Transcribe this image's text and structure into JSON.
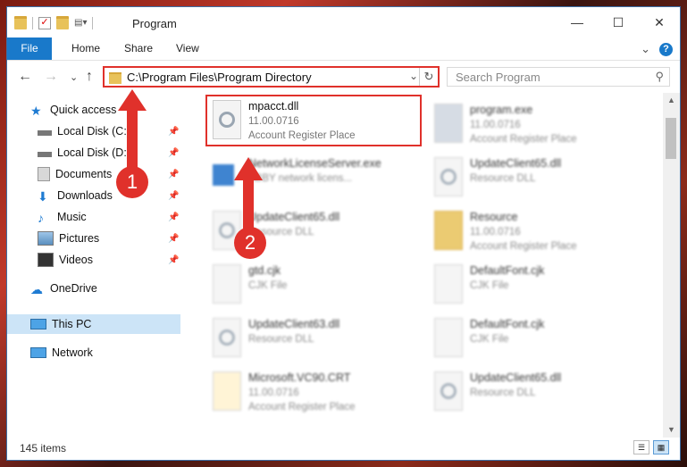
{
  "window": {
    "title": "Program",
    "minimize": "—",
    "maximize": "☐",
    "close": "✕"
  },
  "ribbon": {
    "file": "File",
    "home": "Home",
    "share": "Share",
    "view": "View",
    "collapse": "⌄",
    "help": "?"
  },
  "nav": {
    "back": "←",
    "forward": "→",
    "recent": "⌄",
    "up": "↑"
  },
  "address": {
    "path": "C:\\Program Files\\Program Directory",
    "dropdown": "⌄",
    "refresh": "↻"
  },
  "search": {
    "placeholder": "Search Program",
    "icon": "⚲"
  },
  "sidebar": {
    "items": [
      {
        "label": "Quick access",
        "icon": "star-icon"
      },
      {
        "label": "Local Disk (C:)",
        "icon": "drive-icon"
      },
      {
        "label": "Local Disk (D:)",
        "icon": "drive-icon"
      },
      {
        "label": "Documents",
        "icon": "documents-icon"
      },
      {
        "label": "Downloads",
        "icon": "download-icon"
      },
      {
        "label": "Music",
        "icon": "music-icon"
      },
      {
        "label": "Pictures",
        "icon": "pictures-icon"
      },
      {
        "label": "Videos",
        "icon": "videos-icon"
      },
      {
        "label": "OneDrive",
        "icon": "cloud-icon"
      },
      {
        "label": "This PC",
        "icon": "computer-icon"
      },
      {
        "label": "Network",
        "icon": "network-icon"
      }
    ],
    "pin": "📌"
  },
  "files": {
    "col1": [
      {
        "name": "mpacct.dll",
        "l2": "11.00.0716",
        "l3": "Account Register Place"
      },
      {
        "name": "NetworkLicenseServer.exe",
        "l2": "ABBY network licens...",
        "l3": ""
      },
      {
        "name": "UpdateClient65.dll",
        "l2": "Resource DLL",
        "l3": ""
      },
      {
        "name": "gtd.cjk",
        "l2": "CJK File",
        "l3": ""
      },
      {
        "name": "UpdateClient63.dll",
        "l2": "Resource DLL",
        "l3": ""
      },
      {
        "name": "Microsoft.VC90.CRT",
        "l2": "11.00.0716",
        "l3": "Account Register Place"
      }
    ],
    "col2": [
      {
        "name": "program.exe",
        "l2": "11.00.0716",
        "l3": "Account Register Place"
      },
      {
        "name": "UpdateClient65.dll",
        "l2": "Resource DLL",
        "l3": ""
      },
      {
        "name": "Resource",
        "l2": "11.00.0716",
        "l3": "Account Register Place"
      },
      {
        "name": "DefaultFont.cjk",
        "l2": "CJK File",
        "l3": ""
      },
      {
        "name": "DefaultFont.cjk",
        "l2": "CJK File",
        "l3": ""
      },
      {
        "name": "UpdateClient65.dll",
        "l2": "Resource DLL",
        "l3": ""
      }
    ]
  },
  "status": {
    "count": "145 items"
  },
  "annotations": {
    "one": "1",
    "two": "2"
  },
  "colors": {
    "accent": "#1979ca",
    "annotation": "#e0312b",
    "selection": "#cce4f7"
  }
}
